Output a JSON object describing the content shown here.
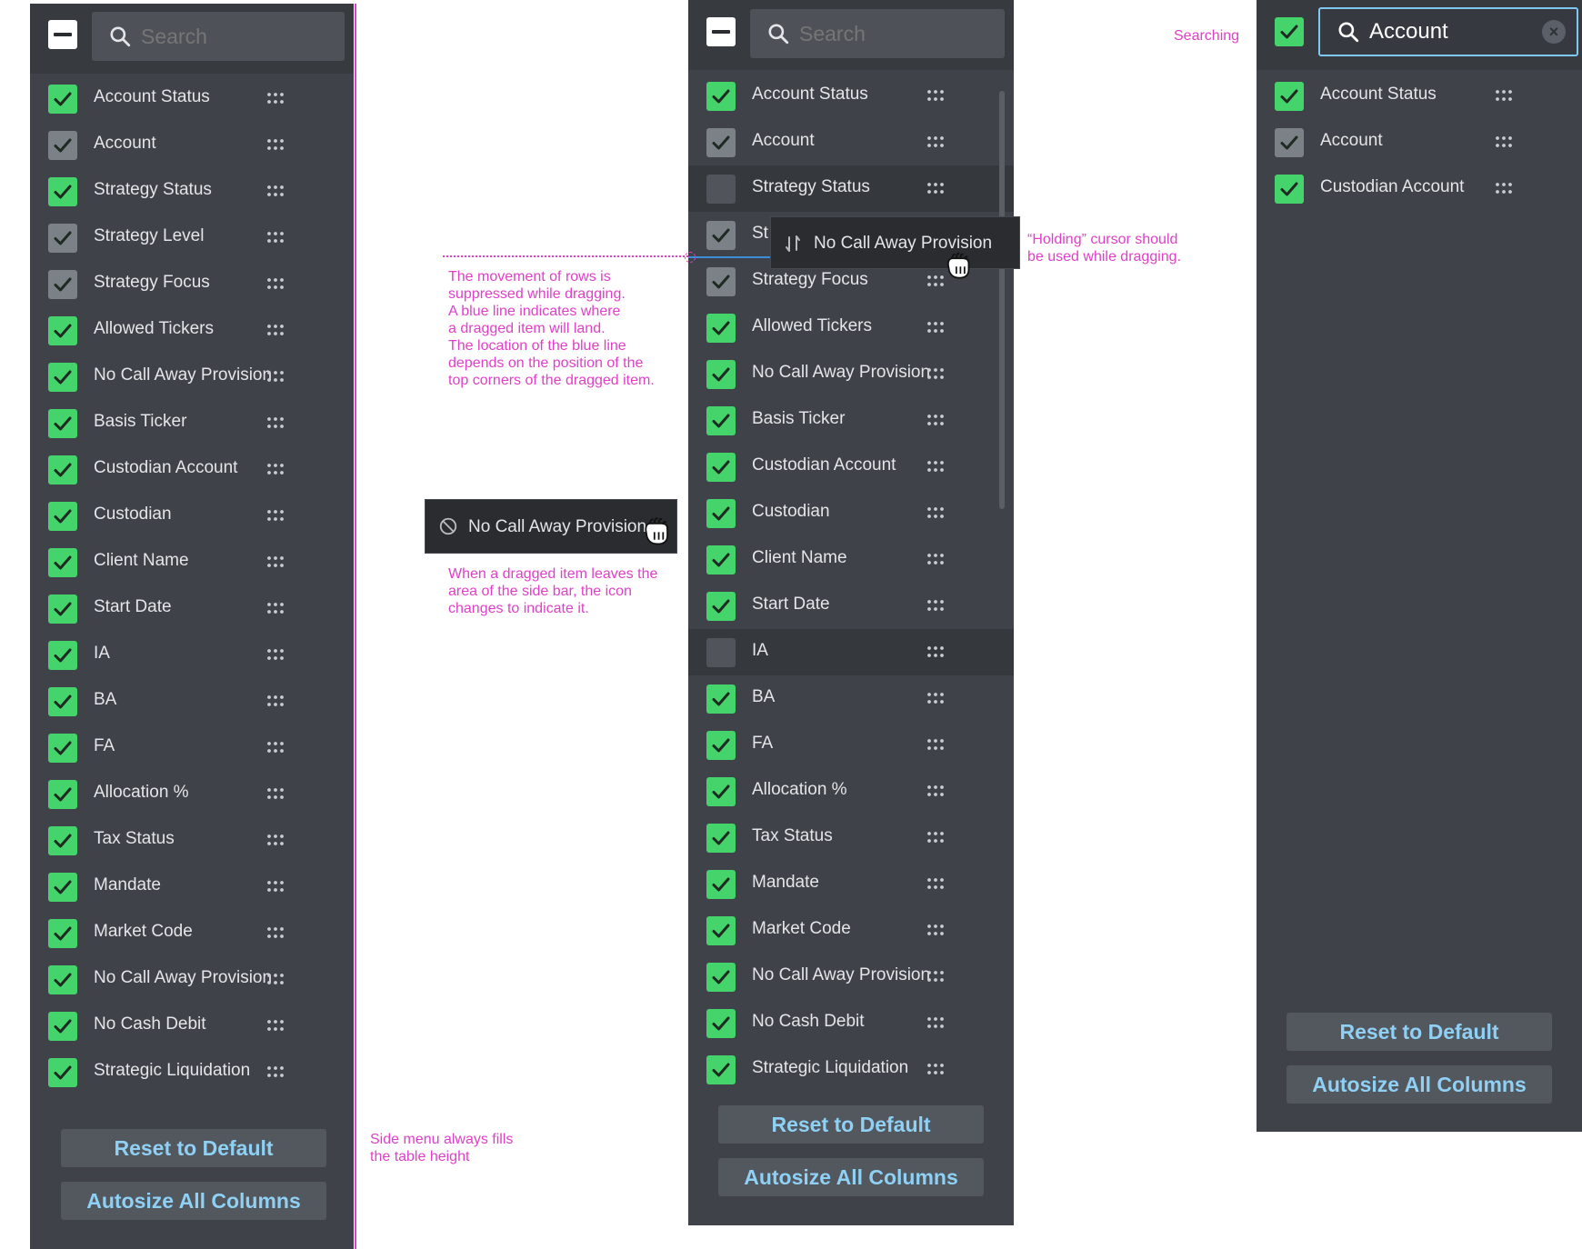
{
  "search_placeholder": "Search",
  "columns": [
    "Account Status",
    "Account",
    "Strategy Status",
    "Strategy Level",
    "Strategy Focus",
    "Allowed Tickers",
    "No Call Away Provision",
    "Basis Ticker",
    "Custodian Account",
    "Custodian",
    "Client Name",
    "Start Date",
    "IA",
    "BA",
    "FA",
    "Allocation %",
    "Tax Status",
    "Mandate",
    "Market Code",
    "No Call Away Provision",
    "No Cash Debit",
    "Strategic Liquidation"
  ],
  "panel2_cut_label": "St",
  "drag_item_label": "No Call Away Provision",
  "search": {
    "value": "Account",
    "results": [
      "Account Status",
      "Account",
      "Custodian Account"
    ]
  },
  "buttons": {
    "reset": "Reset to Default",
    "autosize": "Autosize All Columns"
  },
  "notes": {
    "searching": "Searching",
    "fill": "Side menu always fills\nthe table height",
    "movement": "The movement of rows is\nsuppressed while dragging.\nA blue line indicates where\na dragged item will land.\nThe location of the blue line\ndepends on the position of the\ntop corners of the dragged item.",
    "holding": "“Holding” cursor should\nbe used while dragging.",
    "leaves": "When a dragged item leaves the\narea of the side bar, the icon\nchanges to indicate it."
  },
  "colors": {
    "panel": "#3f4248",
    "checked": "#45d46b",
    "accent_text": "#8fd0f5",
    "annotation": "#e040c8",
    "drop_line": "#3a8fd8"
  },
  "icons": [
    "search-icon",
    "check-icon",
    "grip-icon",
    "clear-icon",
    "not-allowed-icon",
    "grab-hand-icon",
    "reorder-arrows-icon"
  ]
}
